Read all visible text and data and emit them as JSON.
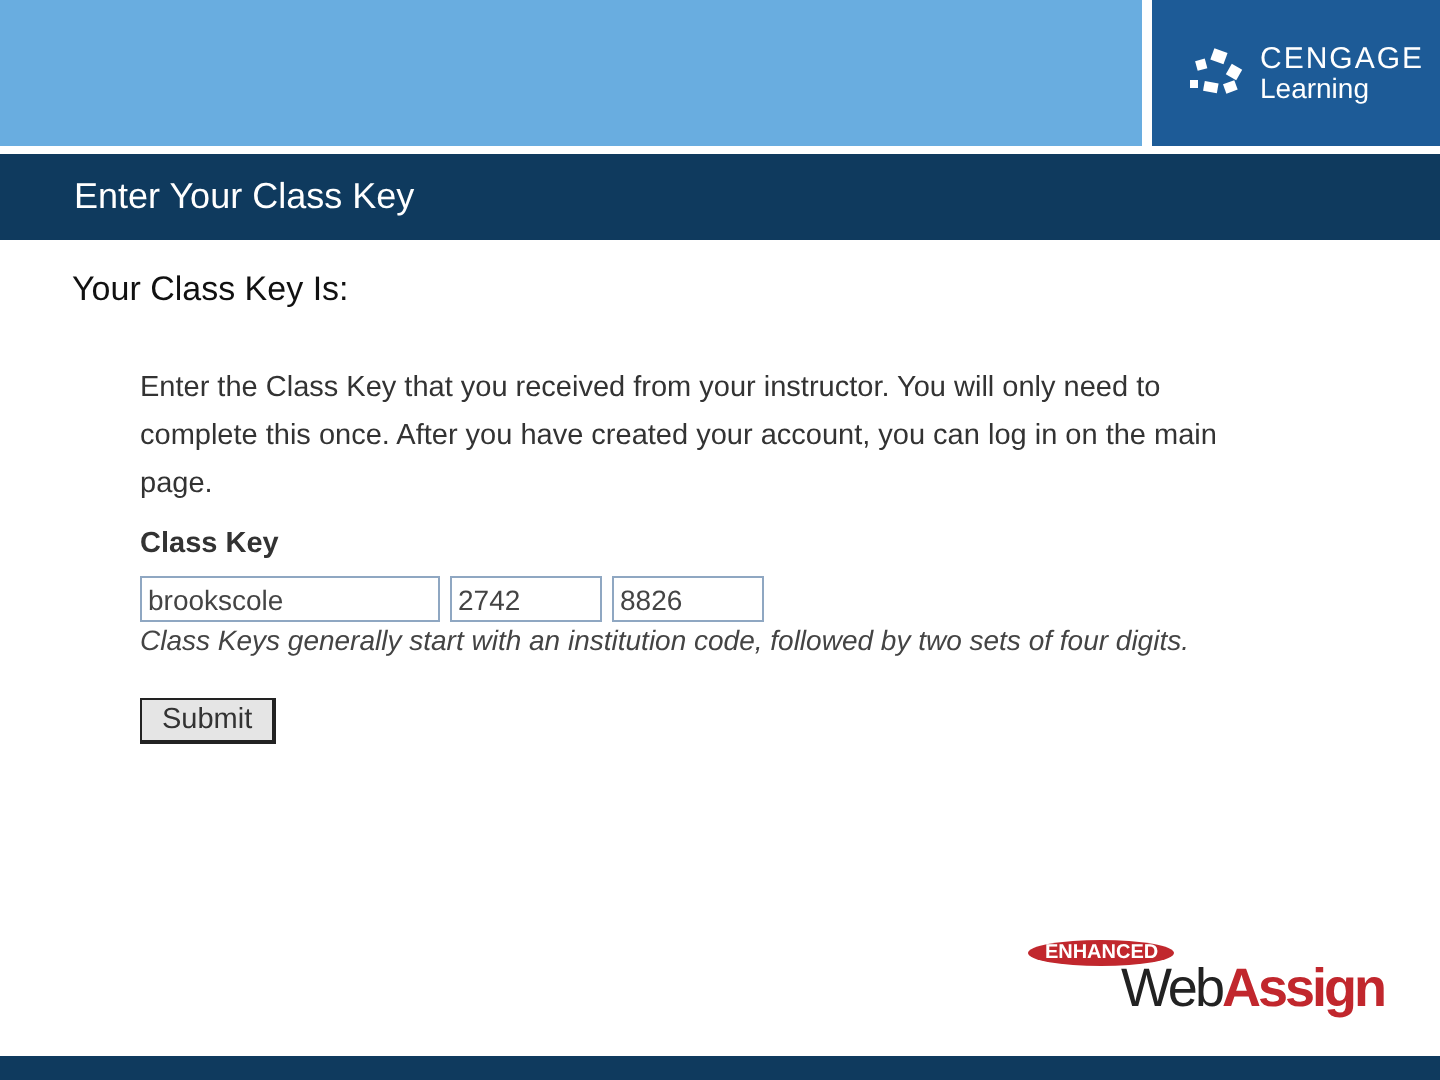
{
  "header": {
    "logo": {
      "line_1": "CENGAGE",
      "line_2": "Learning"
    }
  },
  "title_bar": {
    "title": "Enter Your Class Key"
  },
  "heading": "Your Class Key Is:",
  "form": {
    "instructions": "Enter the Class Key that you received from your instructor. You will only need to complete this once. After you have created your account, you can log in on the main page.",
    "label": "Class Key",
    "fields": [
      {
        "value": "brookscole",
        "kind": "wide"
      },
      {
        "value": "2742",
        "kind": "narrow"
      },
      {
        "value": "8826",
        "kind": "narrow"
      }
    ],
    "hint": "Class Keys generally start with an institution code, followed by two sets of four digits.",
    "button": "Submit"
  },
  "footer_logo": {
    "badge": "ENHANCED",
    "word_1": "Web",
    "word_2": "Assign"
  }
}
